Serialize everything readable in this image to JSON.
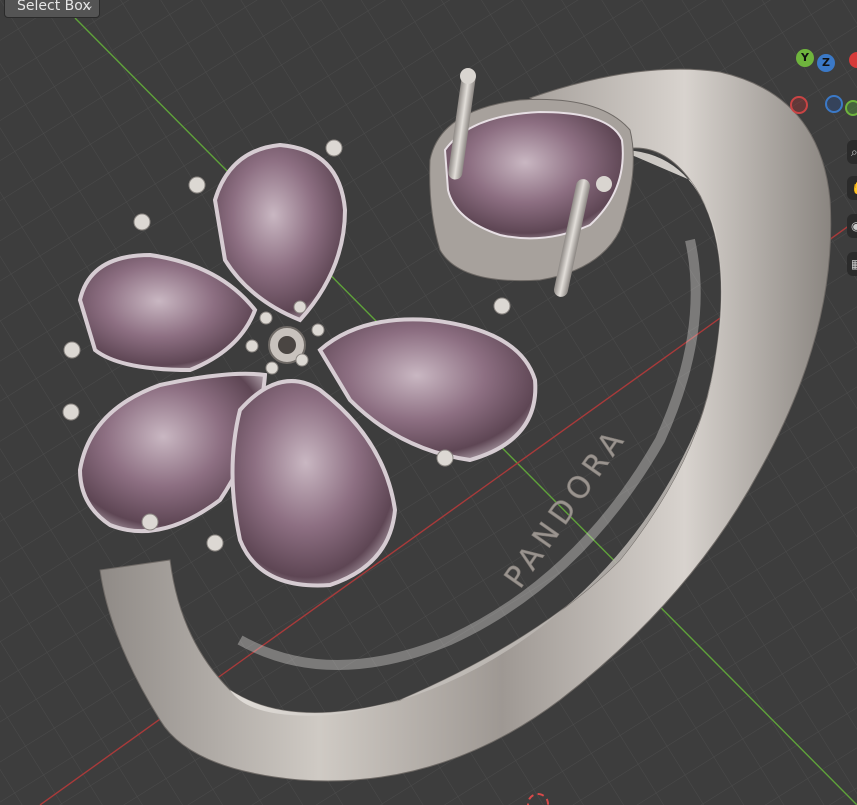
{
  "toolbar": {
    "select_mode_label": "Select Box"
  },
  "navigation_gizmo": {
    "y_label": "Y",
    "z_label": "Z",
    "x_color": "#d63a3a",
    "y_color": "#6fb43d",
    "z_color": "#3b79c7"
  },
  "viewport": {
    "background_color": "#3d3d3d",
    "grid_color": "#4a4a4a",
    "x_axis_color": "#a83a3a",
    "y_axis_color": "#5fa23a"
  },
  "model": {
    "engraving_text": "PANDORA",
    "metal_color": "#b9b3ad",
    "gem_color": "#8c6a7a"
  },
  "side_panel": {
    "icons": [
      "hand-icon",
      "camera-icon",
      "grid-icon",
      "perspective-icon"
    ]
  }
}
